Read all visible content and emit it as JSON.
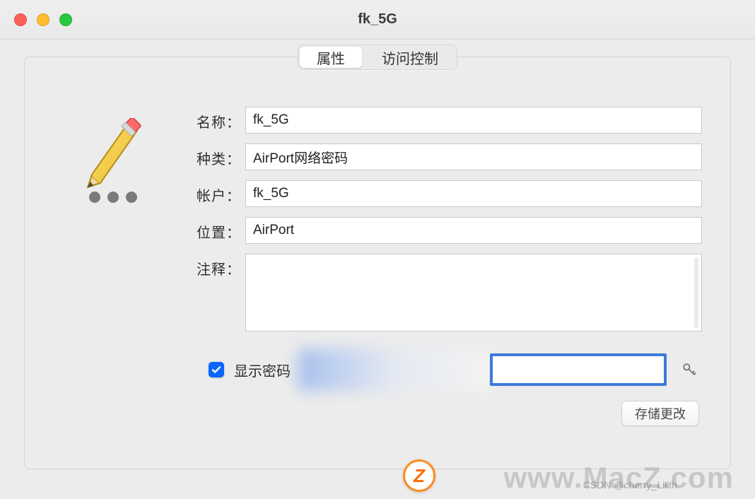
{
  "window": {
    "title": "fk_5G"
  },
  "tabs": {
    "attributes": "属性",
    "access_control": "访问控制"
  },
  "fields": {
    "name_label": "名称：",
    "name_value": "fk_5G",
    "kind_label": "种类：",
    "kind_value": "AirPort网络密码",
    "account_label": "帐户：",
    "account_value": "fk_5G",
    "where_label": "位置：",
    "where_value": "AirPort",
    "comments_label": "注释：",
    "comments_value": ""
  },
  "show_password": {
    "label": "显示密码",
    "checked": true,
    "value": ""
  },
  "buttons": {
    "save": "存储更改"
  },
  "watermark": {
    "site": "www.MacZ.com",
    "csdn": "CSDN @cherry_Lilith",
    "badge": "Z"
  }
}
